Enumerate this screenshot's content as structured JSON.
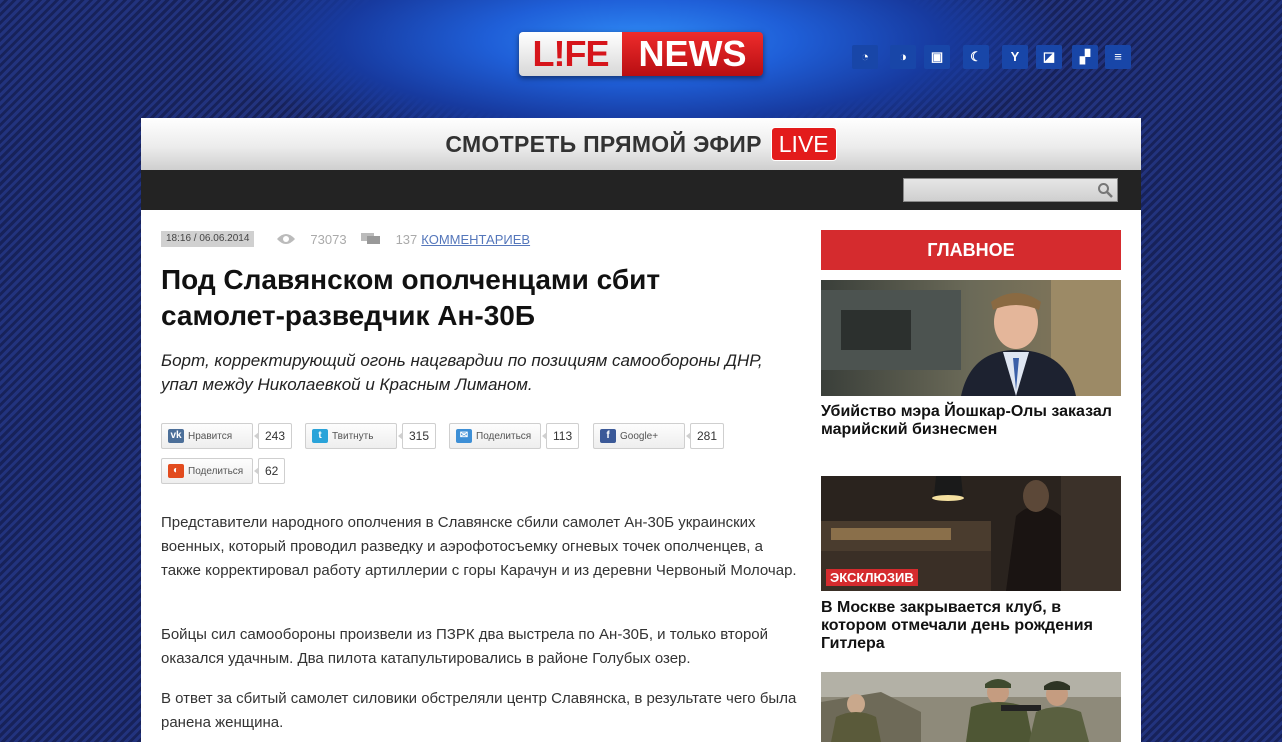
{
  "header": {
    "logo_left": "L!FE",
    "logo_right": "NEWS",
    "social_icons": [
      "sound-icon",
      "live-icon",
      "ok-icon",
      "lj-icon",
      "youtube-icon",
      "google-icon",
      "flickr-icon",
      "rss-icon"
    ],
    "social_glyphs": [
      "◔",
      "◑",
      "▣",
      "☾",
      "Y",
      "◪",
      "▞",
      "≡"
    ]
  },
  "live_bar": {
    "text": "СМОТРЕТЬ ПРЯМОЙ ЭФИР",
    "badge": "LIVE"
  },
  "search": {
    "placeholder": ""
  },
  "article": {
    "datetime": "18:16 / 06.06.2014",
    "views": "73073",
    "comments_count": "137",
    "comments_label": "КОММЕНТАРИЕВ",
    "title": "Под Славянском ополченцами сбит самолет-разведчик Ан-30Б",
    "lead": "Борт, корректирующий огонь нацгвардии по позициям самообороны ДНР, упал между Николаевкой и Красным Лиманом.",
    "share": [
      {
        "network": "vk",
        "label": "Нравится",
        "count": "243",
        "color": "#4c6f99",
        "glyph": "vk"
      },
      {
        "network": "twitter",
        "label": "Твитнуть",
        "count": "315",
        "color": "#29a3d9",
        "glyph": "t"
      },
      {
        "network": "mail",
        "label": "Поделиться",
        "count": "113",
        "color": "#3d8fd6",
        "glyph": "✉"
      },
      {
        "network": "facebook",
        "label": "Google+",
        "count": "281",
        "color": "#3b5998",
        "glyph": "f"
      },
      {
        "network": "odnoklassniki",
        "label": "Поделиться",
        "count": "62",
        "color": "#e24b1e",
        "glyph": "◐"
      }
    ],
    "paragraphs": [
      "Представители народного ополчения в Славянске сбили самолет Ан-30Б украинских военных, который проводил разведку и аэрофотосъемку огневых точек ополченцев, а также корректировал работу артиллерии с горы Карачун и из деревни Червоный Молочар.",
      "Бойцы сил самообороны произвели из ПЗРК два выстрела по Ан-30Б, и только второй оказался удачным. Два пилота катапультировались в районе Голубых озер.",
      "В ответ за сбитый самолет силовики обстреляли центр Славянска, в результате чего была ранена женщина."
    ]
  },
  "sidebar": {
    "heading": "ГЛАВНОЕ",
    "items": [
      {
        "title": "Убийство мэра Йошкар-Олы заказал марийский бизнесмен"
      },
      {
        "title": "В Москве закрывается клуб, в котором отмечали день рождения Гитлера",
        "badge": "ЭКСКЛЮЗИВ"
      },
      {
        "title": ""
      }
    ]
  },
  "colors": {
    "accent_red": "#d52b2e",
    "link_blue": "#5577bb",
    "background_navy": "#1c2a6e"
  }
}
